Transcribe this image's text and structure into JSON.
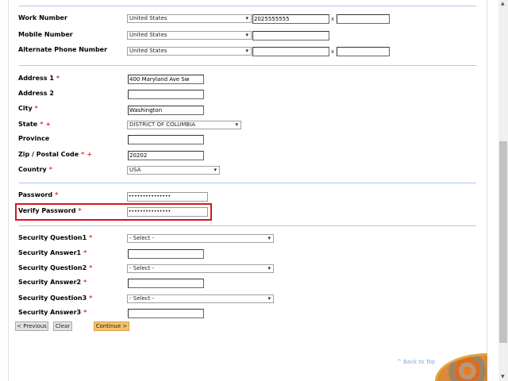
{
  "phones": [
    {
      "label": "Work Number",
      "country": "United States",
      "number": "2025555555",
      "has_ext": true,
      "ext": "",
      "ext_label": "x"
    },
    {
      "label": "Mobile Number",
      "country": "United States",
      "number": "",
      "has_ext": false
    },
    {
      "label": "Alternate Phone Number",
      "country": "United States",
      "number": "",
      "has_ext": true,
      "ext": "",
      "ext_label": "x"
    }
  ],
  "address": {
    "address1_label": "Address 1",
    "address1": "400 Maryland Ave Sw",
    "address2_label": "Address 2",
    "address2": "",
    "city_label": "City",
    "city": "Washington",
    "state_label": "State",
    "state": "DISTRICT OF COLUMBIA",
    "province_label": "Province",
    "province": "",
    "zip_label": "Zip / Postal Code",
    "zip": "20202",
    "country_label": "Country",
    "country": "USA"
  },
  "required_mark": "*",
  "plus_mark": "+",
  "password": {
    "label": "Password",
    "value": "•••••••••••••••",
    "verify_label": "Verify Password",
    "verify_value": "•••••••••••••••"
  },
  "security": {
    "q1_label": "Security Question1",
    "a1_label": "Security Answer1",
    "q2_label": "Security Question2",
    "a2_label": "Security Answer2",
    "q3_label": "Security Question3",
    "a3_label": "Security Answer3",
    "select_placeholder": "- Select -"
  },
  "buttons": {
    "previous": "< Previous",
    "clear": "Clear",
    "continue": "Continue >"
  },
  "back_to_top": "^ Back to Top",
  "chevron": "⌄",
  "colors": {
    "required": "#e03030",
    "highlight": "#d9141c",
    "primary_button": "#f5c26b"
  }
}
